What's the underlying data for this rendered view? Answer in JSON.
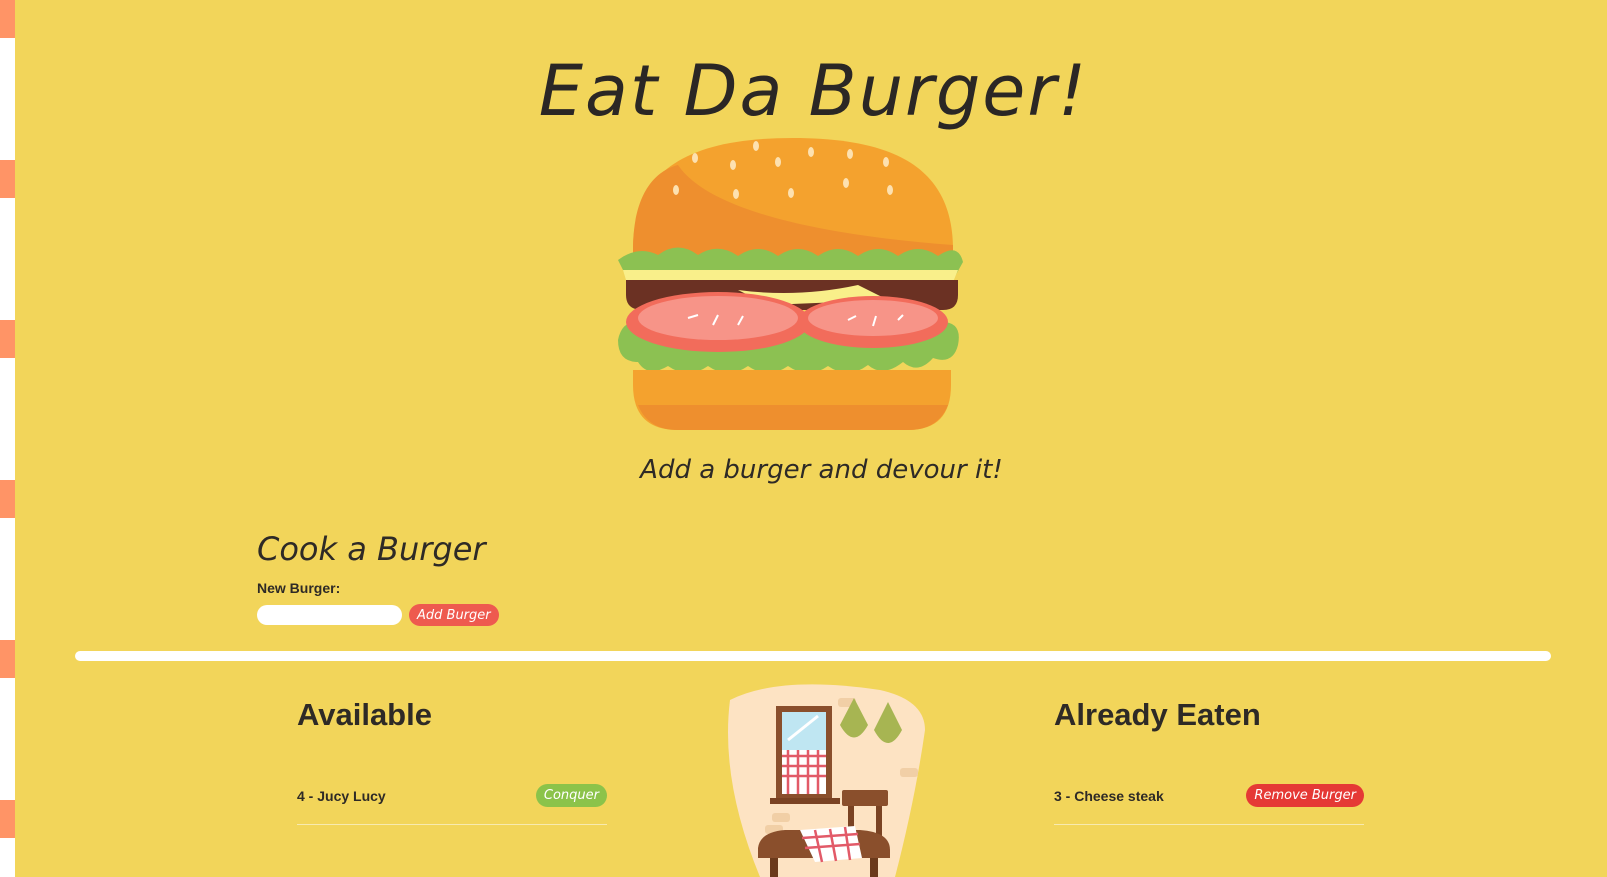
{
  "header": {
    "title": "Eat Da Burger!",
    "subtitle": "Add a burger and devour it!"
  },
  "cook": {
    "title": "Cook a Burger",
    "label": "New Burger:",
    "input_value": "",
    "button_label": "Add Burger"
  },
  "available": {
    "title": "Available",
    "items": [
      {
        "text": "4 - Jucy Lucy",
        "action": "Conquer"
      }
    ]
  },
  "eaten": {
    "title": "Already Eaten",
    "items": [
      {
        "text": "3 - Cheese steak",
        "action": "Remove Burger"
      }
    ]
  },
  "icons": {
    "hero": "burger-illustration",
    "decor": "kitchen-room-illustration"
  },
  "colors": {
    "background": "#f2d55a",
    "accent": "#ee5a4f",
    "conquer": "#8bc34a",
    "remove": "#e53935"
  }
}
